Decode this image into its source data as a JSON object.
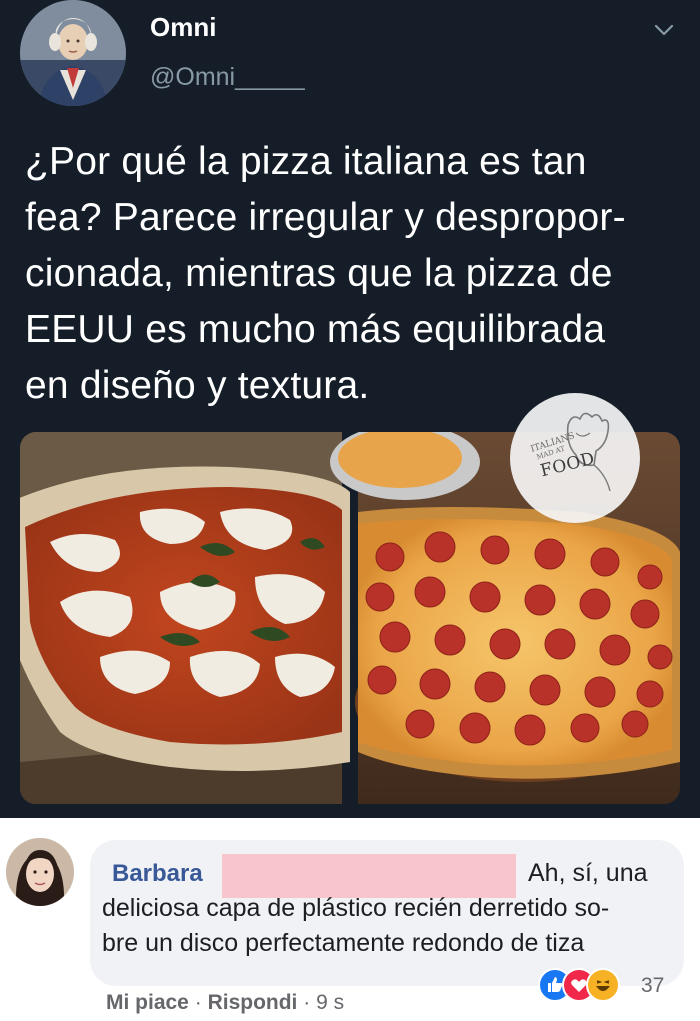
{
  "tweet": {
    "display_name": "Omni",
    "handle": "@Omni_____",
    "text_lines": [
      "¿Por qué la pizza italiana es tan",
      "fea? Parece irregular y despropor-",
      "cionada, mientras que la pizza de",
      "EEUU es mucho más equilibrada",
      "en diseño y textura."
    ],
    "menu_icon": "chevron-down-icon",
    "logo": {
      "small_text_1": "ITALIANS",
      "small_text_2": "MAD AT",
      "food_text": "FOOD"
    }
  },
  "comment": {
    "author": "Barbara",
    "text_lines": [
      "Ah, sí, una",
      "deliciosa capa de plástico recién derretido so-",
      "bre un disco perfectamente redondo de tiza"
    ],
    "reaction_icons": [
      "like-icon",
      "love-icon",
      "haha-icon"
    ],
    "reaction_count": "37",
    "actions": {
      "like": "Mi piace",
      "sep1": "·",
      "reply": "Rispondi",
      "sep2": "·",
      "time": "9 s"
    }
  },
  "colors": {
    "tweet_bg": "#151e28",
    "handle_gray": "#8899a6",
    "fb_name_blue": "#385898",
    "bubble_gray": "#f0f2f5",
    "redaction_pink": "#f8c5cc"
  }
}
